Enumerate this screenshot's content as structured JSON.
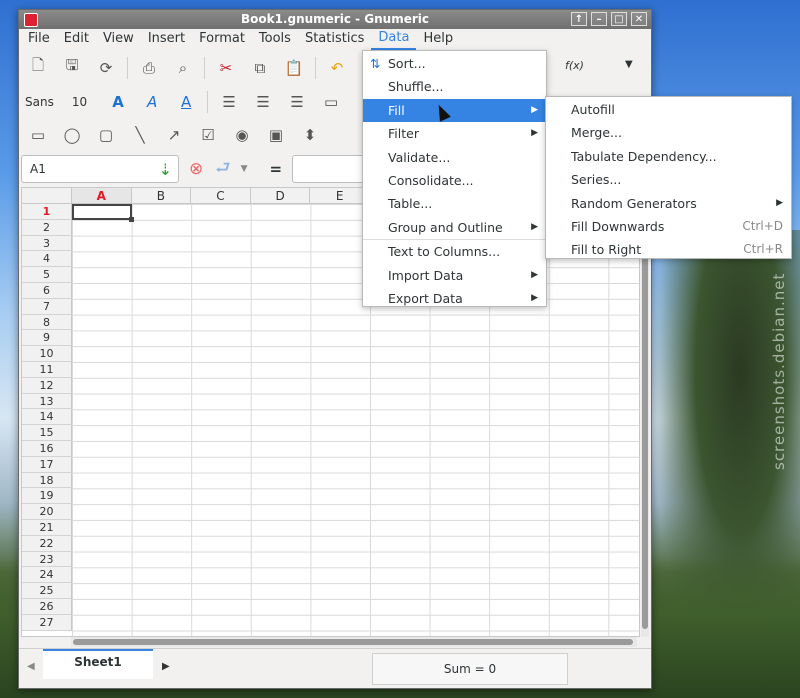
{
  "window": {
    "title": "Book1.gnumeric - Gnumeric",
    "controls": [
      "↑",
      "–",
      "□",
      "✕"
    ]
  },
  "menubar": [
    "File",
    "Edit",
    "View",
    "Insert",
    "Format",
    "Tools",
    "Statistics",
    "Data",
    "Help"
  ],
  "toolbar": {
    "font_name": "Sans",
    "font_size": "10",
    "function_label": "f(x)"
  },
  "formula_bar": {
    "cell_ref": "A1",
    "equals": "="
  },
  "grid": {
    "columns": [
      "A",
      "B",
      "C",
      "D",
      "E"
    ],
    "rows": [
      "1",
      "2",
      "3",
      "4",
      "5",
      "6",
      "7",
      "8",
      "9",
      "10",
      "11",
      "12",
      "13",
      "14",
      "15",
      "16",
      "17",
      "18",
      "19",
      "20",
      "21",
      "22",
      "23",
      "24",
      "25",
      "26",
      "27"
    ],
    "selected_cell": "A1"
  },
  "data_menu": {
    "items": [
      "Sort...",
      "Shuffle...",
      "Fill",
      "Filter",
      "Validate...",
      "Consolidate...",
      "Table...",
      "Group and Outline",
      "Text to Columns...",
      "Import Data",
      "Export Data"
    ]
  },
  "fill_menu": {
    "items": [
      "Autofill",
      "Merge...",
      "Tabulate Dependency...",
      "Series...",
      "Random Generators",
      "Fill Downwards",
      "Fill to Right"
    ],
    "accels": {
      "fill_downwards": "Ctrl+D",
      "fill_to_right": "Ctrl+R"
    }
  },
  "statusbar": {
    "sheet_tab": "Sheet1",
    "sum": "Sum = 0"
  },
  "desktop": {
    "watermark": "screenshots.debian.net"
  },
  "colors": {
    "accent": "#3584e4",
    "active_cell_header": "#e01b24"
  }
}
